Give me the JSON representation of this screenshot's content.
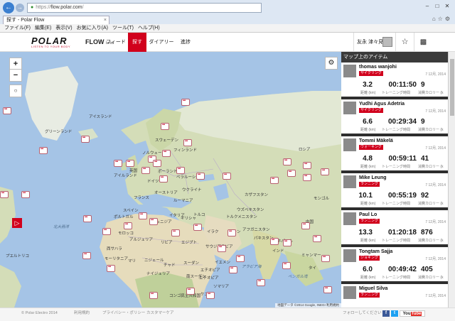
{
  "browser": {
    "url_prefix": "https://",
    "url_host": "flow.polar.com",
    "url_path": "/",
    "tab_title": "探す - Polar Flow",
    "menu": [
      "ファイル(F)",
      "編集(E)",
      "表示(V)",
      "お気に入り(A)",
      "ツール(T)",
      "ヘルプ(H)"
    ]
  },
  "header": {
    "logo_text": "POLAR",
    "tagline": "LISTEN TO YOUR BODY",
    "flow_label": "FLOW",
    "beta_label": "beta",
    "nav": [
      "フィード",
      "探す",
      "ダイアリー",
      "進捗"
    ],
    "user_name": "友永 津々見"
  },
  "sidebar": {
    "title": "マップ上のアイテム",
    "labels": {
      "distance": "距離 (km)",
      "time": "トレーニング時間",
      "calories": "消費カロリー (k"
    },
    "activities": [
      {
        "name": "thomas wanjohi",
        "sport": "サイクリング",
        "date": "7 12月, 2014",
        "distance": "3.2",
        "time": "00:11:50",
        "calories": "9"
      },
      {
        "name": "Yudhi Agus Adetria",
        "sport": "サイクリング",
        "date": "7 12月, 2014",
        "distance": "6.6",
        "time": "00:29:34",
        "calories": "9"
      },
      {
        "name": "Tommi Mäkelä",
        "sport": "ウォーキング",
        "date": "7 12月, 2014",
        "distance": "4.8",
        "time": "00:59:11",
        "calories": "41"
      },
      {
        "name": "Mike Leung",
        "sport": "ランニング",
        "date": "7 12月, 2014",
        "distance": "10.1",
        "time": "00:55:19",
        "calories": "92"
      },
      {
        "name": "Paul Lo",
        "sport": "ランニング",
        "date": "7 12月, 2014",
        "distance": "13.3",
        "time": "01:20:18",
        "calories": "876"
      },
      {
        "name": "Tongtam Sajja",
        "sport": "ジョギング",
        "date": "7 12月, 2014",
        "distance": "6.0",
        "time": "00:49:42",
        "calories": "405"
      },
      {
        "name": "Miguel Silva",
        "sport": "ランニング",
        "date": "7 12月, 2014",
        "distance": "",
        "time": "",
        "calories": ""
      }
    ]
  },
  "map": {
    "attribution": "地図データ ©2014 Google, INEGI   利用規約",
    "labels": [
      "グリーンランド",
      "アイスランド",
      "スウェーデン",
      "フィンランド",
      "ノルウェー",
      "ロシア",
      "ベラルーシ",
      "ウクライナ",
      "ドイツ",
      "フランス",
      "スペイン",
      "イタリア",
      "ギリシャ",
      "トルコ",
      "モロッコ",
      "アルジェリア",
      "リビア",
      "エジプト",
      "マリ",
      "ニジェール",
      "チャド",
      "スーダン",
      "エチオピア",
      "ナイジェリア",
      "コンゴ民主共和国",
      "ケニア",
      "サウジアラビア",
      "イラン",
      "イラク",
      "アフガニスタン",
      "パキスタン",
      "インド",
      "カザフスタン",
      "モンゴル",
      "ウズベキスタン",
      "トルクメニスタン",
      "ミャンマー",
      "タイ",
      "北大西洋",
      "モーリタニア",
      "西サハラ",
      "ソマリア",
      "アラビア海",
      "ベンガル湾",
      "英国",
      "アイルランド",
      "ポーランド",
      "オーストリア",
      "ルーマニア",
      "ポルトガル",
      "チュニジア",
      "エチオピア",
      "南スーダン",
      "プエルトリコ",
      "イエメン",
      "ネパール",
      "中国"
    ],
    "zoom_in": "+",
    "zoom_out": "−"
  },
  "footer": {
    "copyright": "© Polar Electro 2014",
    "terms": "利用規約",
    "privacy": "プライバシー・ポリシー",
    "support": "カスタマーケア",
    "follow": "フォローしてください",
    "youtube": "You"
  }
}
